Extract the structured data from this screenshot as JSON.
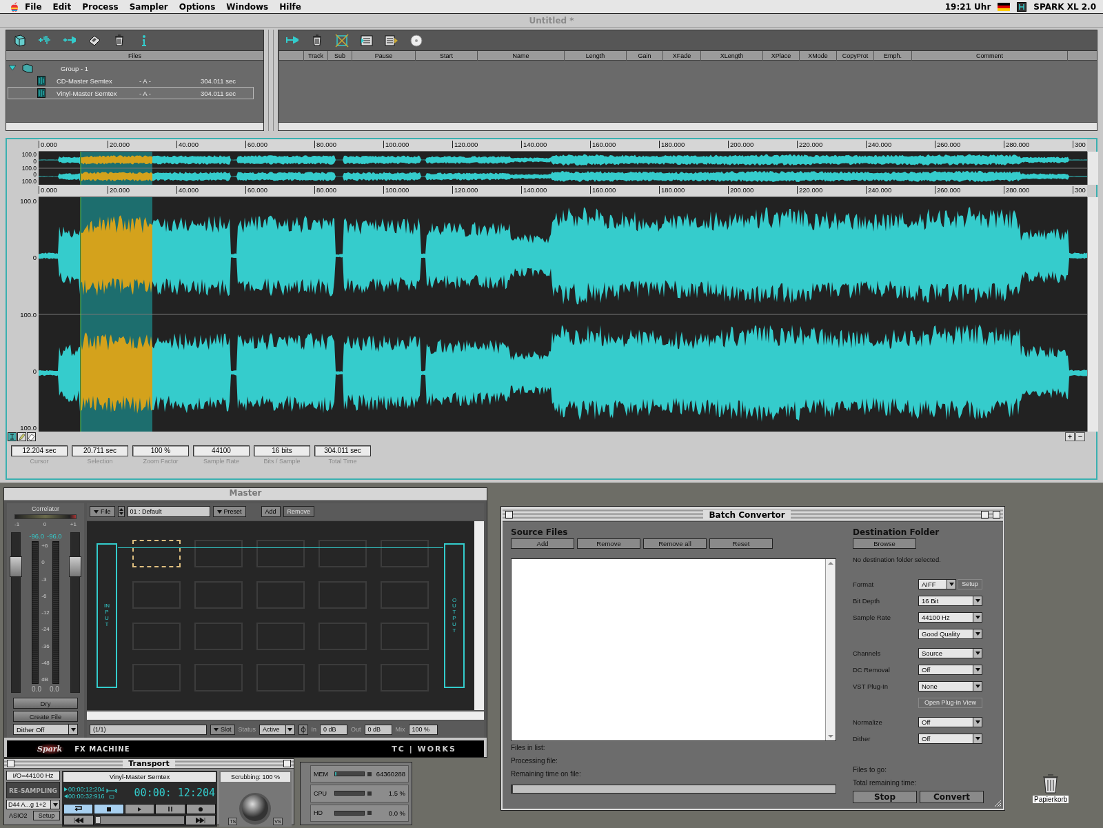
{
  "menu_bar": {
    "menus": [
      "File",
      "Edit",
      "Process",
      "Sampler",
      "Options",
      "Windows",
      "Hilfe"
    ],
    "clock": "19:21 Uhr",
    "app": "SPARK XL 2.0"
  },
  "window": {
    "title": "Untitled *"
  },
  "files_panel": {
    "header": "Files",
    "tree": [
      {
        "label": "Group - 1",
        "expanded": true,
        "children": [
          {
            "name": "CD-Master Semtex",
            "channel": "- A -",
            "length": "304.011 sec",
            "selected": false
          },
          {
            "name": "Vinyl-Master Semtex",
            "channel": "- A -",
            "length": "304.011 sec",
            "selected": true
          }
        ]
      }
    ]
  },
  "playlist": {
    "columns": [
      "Track",
      "Sub",
      "Pause",
      "Start",
      "Name",
      "Length",
      "Gain",
      "XFade",
      "XLength",
      "XPlace",
      "XMode",
      "CopyProt",
      "Emph.",
      "Comment"
    ]
  },
  "waveform": {
    "overview_ruler": [
      "0.000",
      "20.000",
      "40.000",
      "60.000",
      "80.000",
      "100.000",
      "120.000",
      "140.000",
      "160.000",
      "180.000",
      "200.000",
      "220.000",
      "240.000",
      "260.000",
      "280.000",
      "300"
    ],
    "overview_scale": [
      "100.0",
      "0",
      "100.0",
      "0",
      "100.0"
    ],
    "main_ruler": [
      "0.000",
      "20.000",
      "40.000",
      "60.000",
      "80.000",
      "100.000",
      "120.000",
      "140.000",
      "160.000",
      "180.000",
      "200.000",
      "220.000",
      "240.000",
      "260.000",
      "280.000",
      "300"
    ],
    "main_scale": [
      "100.0",
      "0",
      "100.0",
      "0",
      "100.0"
    ],
    "zoom_buttons": [
      "+",
      "−"
    ]
  },
  "info_fields": [
    {
      "value": "12.204 sec",
      "label": "Cursor"
    },
    {
      "value": "20.711 sec",
      "label": "Selection"
    },
    {
      "value": "100 %",
      "label": "Zoom Factor"
    },
    {
      "value": "44100",
      "label": "Sample Rate"
    },
    {
      "value": "16 bits",
      "label": "Bits / Sample"
    },
    {
      "value": "304.011 sec",
      "label": "Total Time"
    }
  ],
  "fx_machine": {
    "title": "Master",
    "correlator": "Correlator",
    "correlator_scale": [
      "-1",
      "0",
      "+1"
    ],
    "peaks": [
      "-96.0",
      "-96.0"
    ],
    "meter_scale": [
      "+6",
      "0",
      "-3",
      "-6",
      "-12",
      "-24",
      "-36",
      "-48",
      "dB"
    ],
    "readings": [
      "0.0",
      "0.0"
    ],
    "faders": [
      {
        "level": 0.8
      },
      {
        "level": 0.8
      }
    ],
    "dry": "Dry",
    "create_file": "Create File",
    "dither": "Dither Off",
    "file_menu": "File",
    "preset_name": "01 : Default",
    "preset_menu": "Preset",
    "add": "Add",
    "remove": "Remove",
    "input_label": "INPUT",
    "output_label": "OUTPUT",
    "slots": [
      {
        "selected": true
      },
      {
        "selected": false
      },
      {
        "selected": false
      },
      {
        "selected": false
      },
      {
        "selected": false
      },
      {
        "selected": false
      },
      {
        "selected": false
      },
      {
        "selected": false
      },
      {
        "selected": false
      },
      {
        "selected": false
      },
      {
        "selected": false
      },
      {
        "selected": false
      },
      {
        "selected": false
      },
      {
        "selected": false
      },
      {
        "selected": false
      },
      {
        "selected": false
      },
      {
        "selected": false
      },
      {
        "selected": false
      },
      {
        "selected": false
      },
      {
        "selected": false
      }
    ],
    "slot_name": "(1/1)",
    "slot_menu": "Slot",
    "status_label": "Status",
    "status": "Active",
    "in_label": "In",
    "in": "0 dB",
    "out_label": "Out",
    "out": "0 dB",
    "mix_label": "Mix",
    "mix": "100 %",
    "brand": "FX MACHINE",
    "logo": "Spark",
    "vendor": "TC | WORKS"
  },
  "batch": {
    "title": "Batch Convertor",
    "source_heading": "Source Files",
    "source_buttons": [
      "Add",
      "Remove",
      "Remove all",
      "Reset"
    ],
    "left_status": [
      "Files in list:",
      "Processing file:",
      "Remaining time on file:"
    ],
    "progress": {
      "level": 0
    },
    "dest_heading": "Destination Folder",
    "browse": "Browse",
    "dest_message": "No destination folder selected.",
    "settings_groups": [
      [
        {
          "kind": "dropdown",
          "label": "Format",
          "value": "AIFF",
          "extra": {
            "label": "Setup",
            "disabled": true
          }
        },
        {
          "kind": "dropdown",
          "label": "Bit Depth",
          "value": "16 Bit"
        },
        {
          "kind": "dropdown",
          "label": "Sample Rate",
          "value": "44100 Hz"
        },
        {
          "kind": "dropdown",
          "value": "Good Quality"
        }
      ],
      [
        {
          "kind": "dropdown",
          "label": "Channels",
          "value": "Source"
        },
        {
          "kind": "dropdown",
          "label": "DC Removal",
          "value": "Off"
        },
        {
          "kind": "dropdown",
          "label": "VST Plug-In",
          "value": "None"
        },
        {
          "kind": "button",
          "value": "Open Plug-In View",
          "disabled": true
        }
      ],
      [
        {
          "kind": "dropdown",
          "label": "Normalize",
          "value": "Off"
        },
        {
          "kind": "dropdown",
          "label": "Dither",
          "value": "Off"
        }
      ]
    ],
    "right_status": [
      "Files to go:",
      "Total remaining time:"
    ],
    "actions": [
      "Stop",
      "Convert"
    ]
  },
  "transport": {
    "title": "Transport",
    "io": "I/O=44100 Hz",
    "resampling": "RE-SAMPLING",
    "device": "D44 A...g 1+2",
    "driver": "ASIO2",
    "setup": "Setup",
    "file": "Vinyl-Master Semtex",
    "time_in": "00:00:12:204",
    "time_out": "00:00:32:916",
    "time": "00:00: 12:204",
    "scrubbing": "Scrubbing: 100 %",
    "ts": "TS",
    "vs": "VS",
    "buttons": [
      {
        "kind": "loop",
        "on": true
      },
      {
        "kind": "stop",
        "on": true
      },
      {
        "kind": "play",
        "on": false
      },
      {
        "kind": "pause",
        "on": false
      },
      {
        "kind": "record",
        "on": false
      }
    ],
    "position": {
      "level": 0.0
    }
  },
  "system_meters": [
    {
      "label": "MEM",
      "value": "64360288",
      "level": 0.05
    },
    {
      "label": "CPU",
      "value": "1.5 %",
      "level": 0
    },
    {
      "label": "HD",
      "value": "0.0 %",
      "level": 0
    }
  ],
  "desktop": {
    "trash": "Papierkorb"
  }
}
